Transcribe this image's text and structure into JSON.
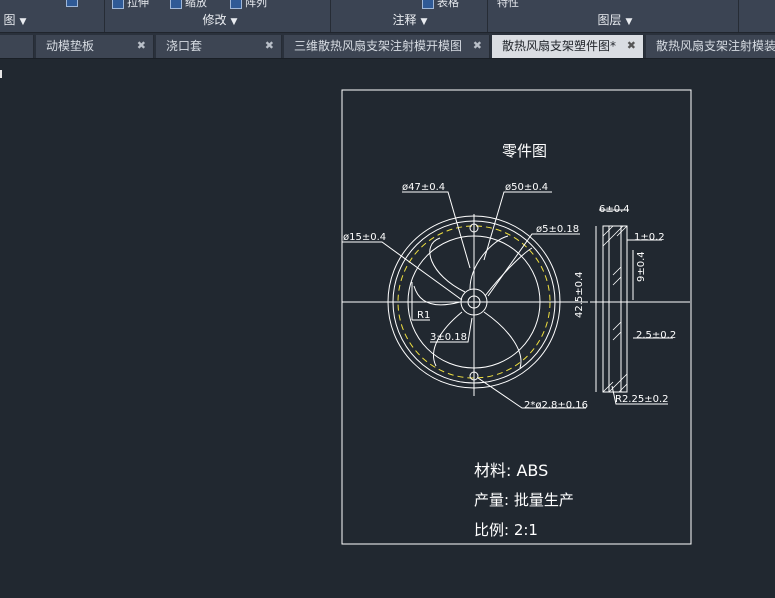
{
  "ribbon": {
    "panels": [
      {
        "label": "图",
        "caret": "▼"
      },
      {
        "label": "修改",
        "caret": "▼"
      },
      {
        "label": "注释",
        "caret": "▼"
      },
      {
        "label": "图层",
        "caret": "▼"
      }
    ],
    "top_tools": [
      "拉伸",
      "缩放",
      "阵列",
      "表格",
      "特性"
    ]
  },
  "tabs": [
    {
      "label": "动模垫板",
      "close": "✖",
      "active": false
    },
    {
      "label": "浇口套",
      "close": "✖",
      "active": false
    },
    {
      "label": "三维散热风扇支架注射模开模图",
      "close": "✖",
      "active": false
    },
    {
      "label": "散热风扇支架塑件图*",
      "close": "✖",
      "active": true
    },
    {
      "label": "散热风扇支架注射模装",
      "close": "",
      "active": false
    }
  ],
  "drawing": {
    "title": "零件图",
    "dims": {
      "d47": "ø47±0.4",
      "d50": "ø50±0.4",
      "d15": "ø15±0.4",
      "d5": "ø5±0.18",
      "r1": "R1",
      "t3": "3±0.18",
      "holes": "2*ø2.8±0.16",
      "w6": "6±0.4",
      "t1": "1±0.2",
      "h9": "9±0.4",
      "h42": "42.5±0.4",
      "t25": "2.5±0.2",
      "r225": "R2.25±0.2"
    },
    "notes": {
      "material": "材料: ABS",
      "production": "产量: 批量生产",
      "scale": "比例: 2:1"
    }
  },
  "colors": {
    "background": "#212830",
    "line": "#ffffff",
    "dashed": "#f0e040",
    "ribbon": "#3b4453",
    "active_tab": "#dadde2"
  }
}
